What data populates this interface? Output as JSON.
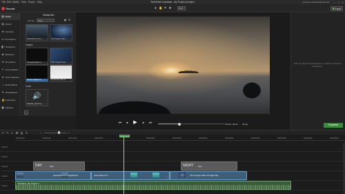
{
  "menubar": {
    "items": [
      "File",
      "Edit",
      "Modify",
      "View",
      "Export",
      "Help"
    ],
    "title": "TechSmith Camtasia - My Project (recipe)*",
    "user": "someone.example@mail.com"
  },
  "toolbar": {
    "record_label": "Record",
    "zoom": "53%",
    "share_label": "Export"
  },
  "sidebar": {
    "items": [
      {
        "label": "Media",
        "icon": "media-icon"
      },
      {
        "label": "Library",
        "icon": "library-icon"
      },
      {
        "label": "Favorites",
        "icon": "star-icon"
      },
      {
        "label": "Annotations",
        "icon": "annotation-icon"
      },
      {
        "label": "Transitions",
        "icon": "transition-icon"
      },
      {
        "label": "Behaviors",
        "icon": "behavior-icon"
      },
      {
        "label": "Animations",
        "icon": "animation-icon"
      },
      {
        "label": "Cursor Effects",
        "icon": "cursor-icon"
      },
      {
        "label": "Voice Narration",
        "icon": "microphone-icon"
      },
      {
        "label": "Audio Effects",
        "icon": "audio-icon"
      },
      {
        "label": "Visual Effects",
        "icon": "effects-icon"
      },
      {
        "label": "Interactivity",
        "icon": "interactivity-icon"
      },
      {
        "label": "Captions",
        "icon": "captions-icon"
      }
    ]
  },
  "mediabin": {
    "title": "Media Bin",
    "sort_label": "Sort By",
    "sort_value": "Type",
    "sections": {
      "images": "Images",
      "audio": "Audio"
    },
    "thumbs": [
      {
        "caption": "Aerial Shot of a Li..."
      },
      {
        "caption": "Time Lapse Video ..."
      },
      {
        "caption": "Camtasia Web Im..."
      },
      {
        "caption": "PNG Image Scree..."
      },
      {
        "caption": "Screen Capture 2..."
      },
      {
        "caption": "Screenshot File.Fi..."
      },
      {
        "caption": "Narration_My Proj..."
      }
    ]
  },
  "canvas": {
    "properties_hint": "Click an object on the timeline or canvas to show its Properties",
    "properties_button": "Properties"
  },
  "playback": {
    "time": "00:00 / 00:20",
    "fps": "30 fps",
    "progress": 0.32
  },
  "timeline": {
    "playhead_time": "0:00:08;02",
    "ticks": [
      "0:00:00;00",
      "0:00:05;00",
      "0:00:10;00",
      "0:00:15;00",
      "0:00:20;00",
      "0:00:25;00",
      "0:00:30;00",
      "0:00:35;00",
      "0:00:40;00",
      "0:00:45;00",
      "0:00:50;00",
      "0:00:55;00"
    ],
    "tracks": [
      "Track 5",
      "Track 4",
      "Track 3",
      "Track 2",
      "Track 1"
    ],
    "clips": {
      "text1": "Text",
      "text1_title": "DAY",
      "text2": "Text",
      "text2_title": "NIGHT",
      "video1": "Aerial Shot of a Lighthouse",
      "video2": "Aerial Shot of a",
      "video3": "Time Lapse Video Of Night Sky",
      "audio1": "Narration_My Project 1"
    }
  },
  "colors": {
    "record": "#d83b3b",
    "accent_green": "#3a8a3a",
    "selection_blue": "#3b6ea8"
  }
}
